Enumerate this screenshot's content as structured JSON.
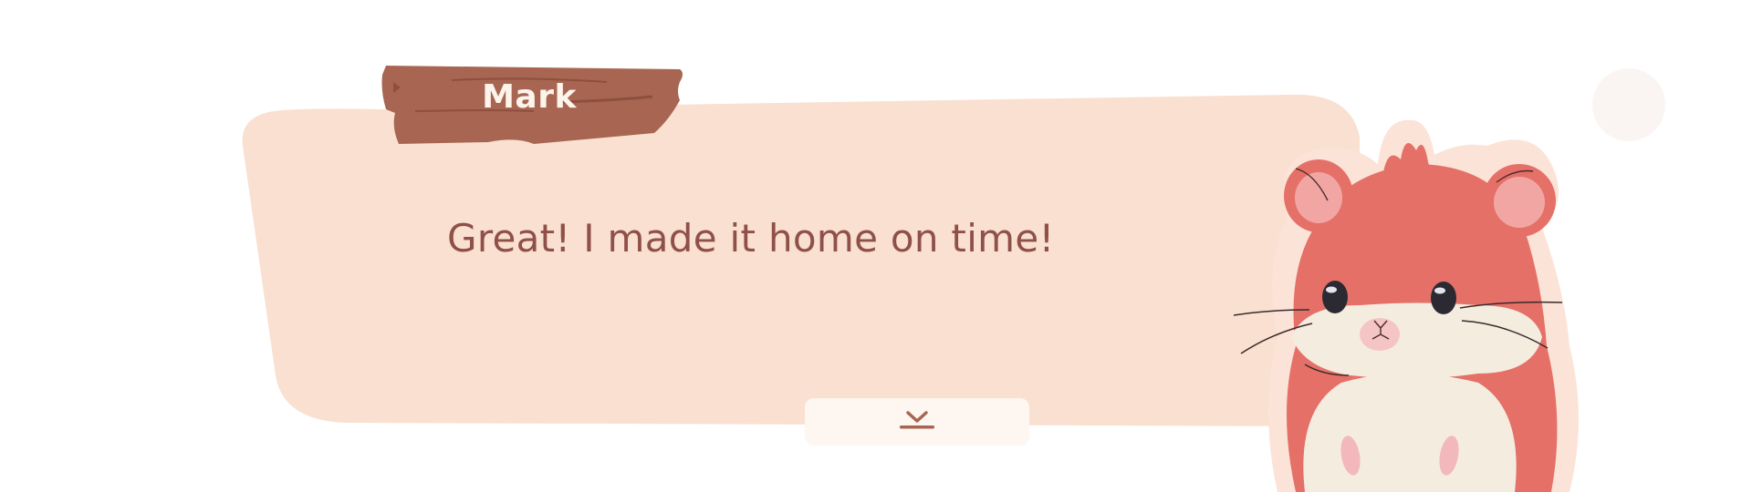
{
  "dialogue": {
    "speaker": "Mark",
    "text": "Great! I made it home on time!"
  },
  "controls": {
    "advance_icon": "chevron-down-to-line"
  },
  "colors": {
    "bubble": "#f9e0d0",
    "nameplate": "#a86652",
    "text": "#8f5048",
    "button_bg": "#fdf6f1",
    "hamster_fur": "#e57068"
  }
}
